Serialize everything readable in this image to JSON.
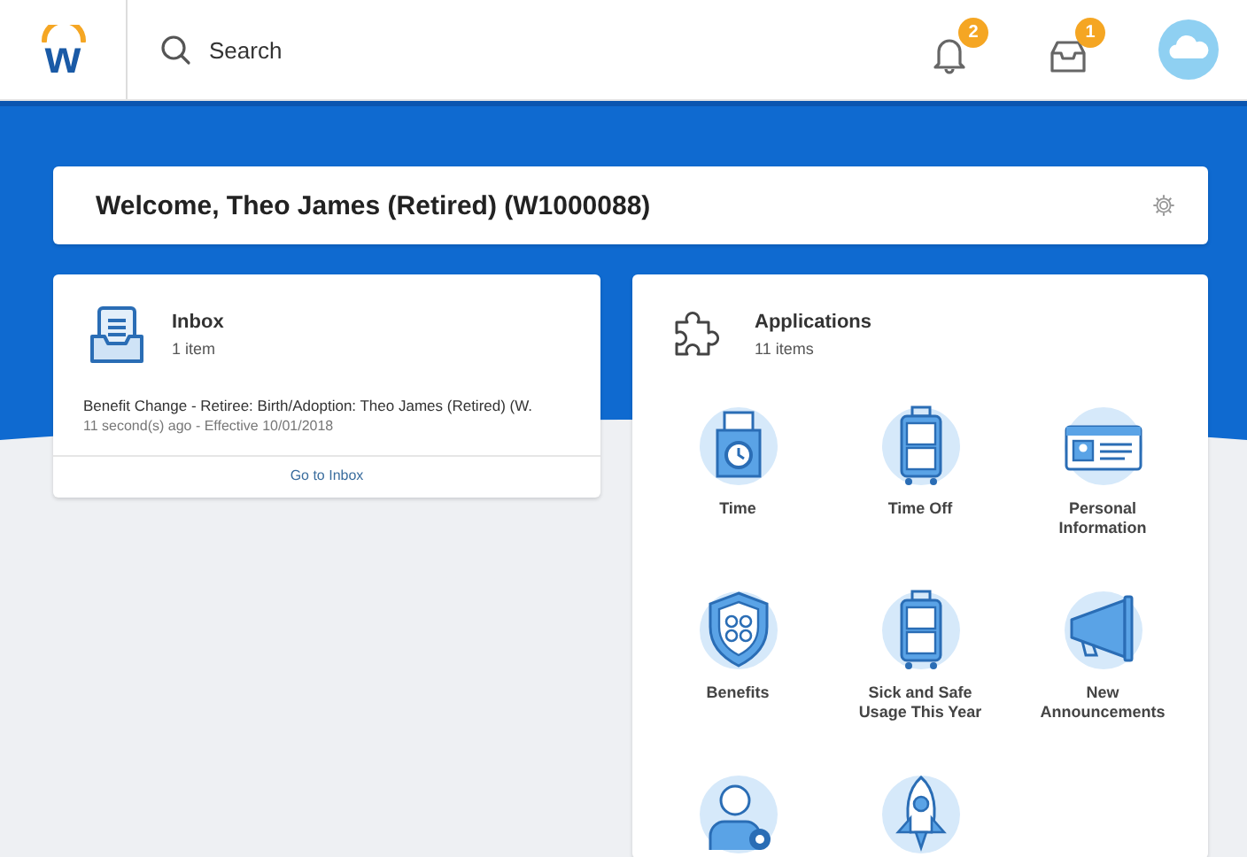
{
  "header": {
    "logo_text": "w",
    "search": {
      "placeholder": "Search"
    },
    "notifications_badge": "2",
    "inbox_badge": "1"
  },
  "welcome": {
    "title": "Welcome, Theo James (Retired) (W1000088)"
  },
  "inbox": {
    "title": "Inbox",
    "count": "1 item",
    "message": "Benefit Change - Retiree: Birth/Adoption: Theo James (Retired) (W.",
    "meta": "11 second(s) ago - Effective 10/01/2018",
    "link": "Go to Inbox"
  },
  "applications": {
    "title": "Applications",
    "count": "11 items",
    "items": [
      {
        "kind": "clock",
        "label": "Time"
      },
      {
        "kind": "suitcase",
        "label": "Time Off"
      },
      {
        "kind": "idcard",
        "label": "Personal Information"
      },
      {
        "kind": "shield",
        "label": "Benefits"
      },
      {
        "kind": "suitcase",
        "label": "Sick and Safe Usage This Year"
      },
      {
        "kind": "megaphone",
        "label": "New Announcements"
      },
      {
        "kind": "person"
      },
      {
        "kind": "rocket"
      }
    ]
  }
}
